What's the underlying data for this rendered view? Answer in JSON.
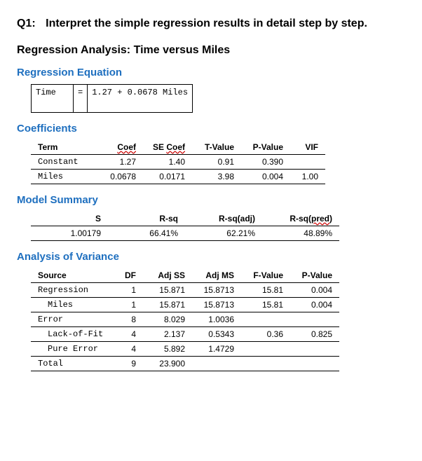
{
  "question": {
    "label": "Q1:",
    "text": "Interpret the simple regression results in detail step by step."
  },
  "analysis_title": "Regression Analysis: Time versus Miles",
  "sections": {
    "equation_title": "Regression Equation",
    "equation": {
      "response": "Time",
      "equals": "=",
      "expression": "1.27 + 0.0678 Miles"
    },
    "coefficients_title": "Coefficients",
    "coef_headers": {
      "term": "Term",
      "coef": "Coef",
      "se": "SE Coef",
      "t": "T-Value",
      "p": "P-Value",
      "vif": "VIF"
    },
    "coef_rows": [
      {
        "term": "Constant",
        "coef": "1.27",
        "se": "1.40",
        "t": "0.91",
        "p": "0.390",
        "vif": ""
      },
      {
        "term": "Miles",
        "coef": "0.0678",
        "se": "0.0171",
        "t": "3.98",
        "p": "0.004",
        "vif": "1.00"
      }
    ],
    "model_summary_title": "Model Summary",
    "ms_headers": {
      "s": "S",
      "rsq": "R-sq",
      "rsqa": "R-sq(adj)",
      "rsqp": "R-sq(pred)"
    },
    "ms_row": {
      "s": "1.00179",
      "rsq": "66.41%",
      "rsqa": "62.21%",
      "rsqp": "48.89%"
    },
    "anova_title": "Analysis of Variance",
    "anova_headers": {
      "source": "Source",
      "df": "DF",
      "adjss": "Adj SS",
      "adjms": "Adj MS",
      "f": "F-Value",
      "p": "P-Value"
    },
    "anova_rows": [
      {
        "source": "Regression",
        "indent": 0,
        "df": "1",
        "adjss": "15.871",
        "adjms": "15.8713",
        "f": "15.81",
        "p": "0.004"
      },
      {
        "source": "Miles",
        "indent": 1,
        "df": "1",
        "adjss": "15.871",
        "adjms": "15.8713",
        "f": "15.81",
        "p": "0.004"
      },
      {
        "source": "Error",
        "indent": 0,
        "df": "8",
        "adjss": "8.029",
        "adjms": "1.0036",
        "f": "",
        "p": ""
      },
      {
        "source": "Lack-of-Fit",
        "indent": 1,
        "df": "4",
        "adjss": "2.137",
        "adjms": "0.5343",
        "f": "0.36",
        "p": "0.825"
      },
      {
        "source": "Pure Error",
        "indent": 1,
        "df": "4",
        "adjss": "5.892",
        "adjms": "1.4729",
        "f": "",
        "p": ""
      },
      {
        "source": "Total",
        "indent": 0,
        "df": "9",
        "adjss": "23.900",
        "adjms": "",
        "f": "",
        "p": ""
      }
    ]
  }
}
